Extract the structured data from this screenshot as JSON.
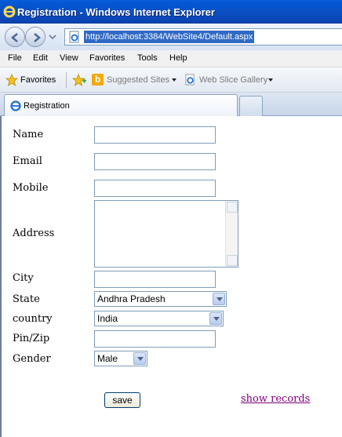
{
  "window": {
    "title": "Registration - Windows Internet Explorer"
  },
  "address_bar": {
    "url": "http://localhost:3384/WebSite4/Default.aspx"
  },
  "menu": [
    "File",
    "Edit",
    "View",
    "Favorites",
    "Tools",
    "Help"
  ],
  "favorites_bar": {
    "favorites_label": "Favorites",
    "suggested_sites": "Suggested Sites",
    "web_slice_gallery": "Web Slice Gallery"
  },
  "tab": {
    "label": "Registration"
  },
  "form": {
    "labels": {
      "name": "Name",
      "email": "Email",
      "mobile": "Mobile",
      "address": "Address",
      "city": "City",
      "state": "State",
      "country": "country",
      "pin": "Pin/Zip",
      "gender": "Gender"
    },
    "values": {
      "name": "",
      "email": "",
      "mobile": "",
      "address": "",
      "city": "",
      "state": "Andhra Pradesh",
      "country": "India",
      "pin": "",
      "gender": "Male"
    },
    "save_label": "save",
    "show_records_label": "show records"
  },
  "colors": {
    "titlebar": "#0a4fc4",
    "link_visited": "#800080",
    "url_highlight": "#316ac5"
  }
}
